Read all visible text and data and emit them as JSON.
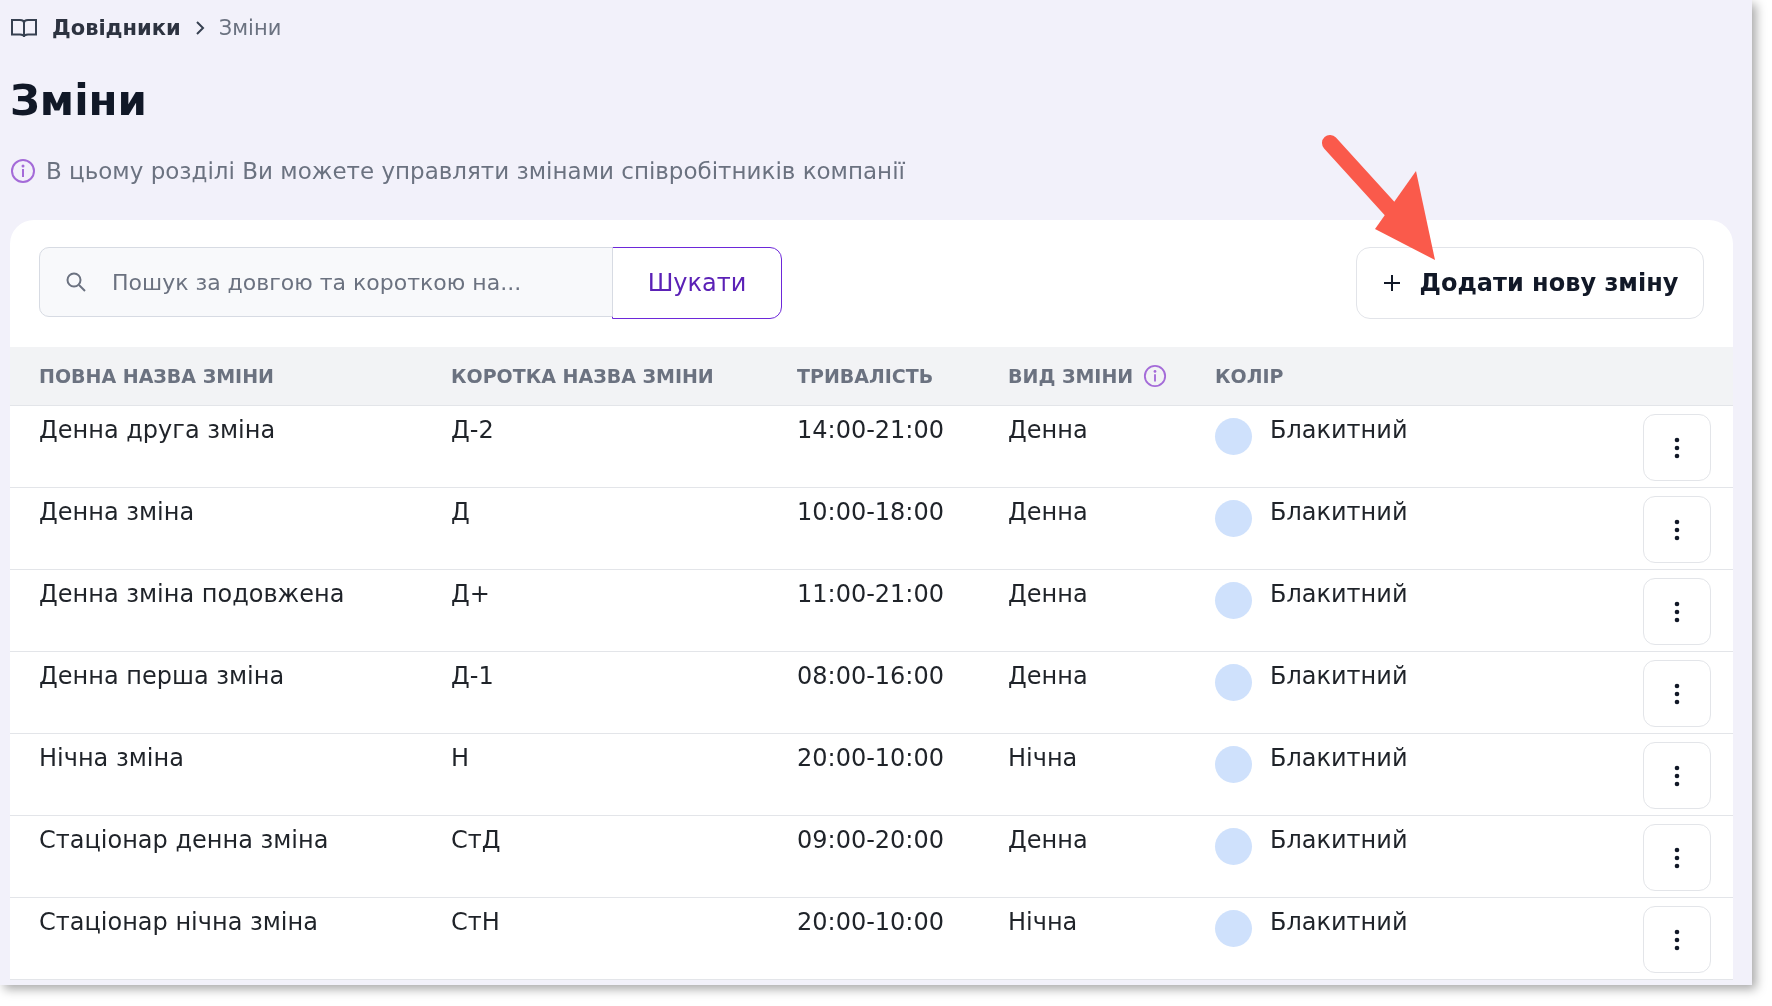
{
  "breadcrumbs": [
    {
      "label": "Довідники",
      "current": false
    },
    {
      "label": "Зміни",
      "current": true
    }
  ],
  "title": "Зміни",
  "info": "В цьому розділі Ви можете управляти змінами співробітників компанії",
  "search": {
    "placeholder": "Пошук за довгою та короткою на...",
    "button": "Шукати"
  },
  "add_button": "Додати нову зміну",
  "table": {
    "columns": [
      {
        "label": "ПОВНА НАЗВА ЗМІНИ",
        "info": false
      },
      {
        "label": "КОРОТКА НАЗВА ЗМІНИ",
        "info": false
      },
      {
        "label": "ТРИВАЛІСТЬ",
        "info": false
      },
      {
        "label": "ВИД ЗМІНИ",
        "info": true
      },
      {
        "label": "КОЛІР",
        "info": false
      }
    ],
    "rows": [
      {
        "full_name": "Денна друга зміна",
        "short_name": "Д-2",
        "duration": "14:00-21:00",
        "type": "Денна",
        "color_name": "Блакитний",
        "color": "#cfe1fc"
      },
      {
        "full_name": "Денна зміна",
        "short_name": "Д",
        "duration": "10:00-18:00",
        "type": "Денна",
        "color_name": "Блакитний",
        "color": "#cfe1fc"
      },
      {
        "full_name": "Денна зміна подовжена",
        "short_name": "Д+",
        "duration": "11:00-21:00",
        "type": "Денна",
        "color_name": "Блакитний",
        "color": "#cfe1fc"
      },
      {
        "full_name": "Денна перша зміна",
        "short_name": "Д-1",
        "duration": "08:00-16:00",
        "type": "Денна",
        "color_name": "Блакитний",
        "color": "#cfe1fc"
      },
      {
        "full_name": "Нічна зміна",
        "short_name": "Н",
        "duration": "20:00-10:00",
        "type": "Нічна",
        "color_name": "Блакитний",
        "color": "#cfe1fc"
      },
      {
        "full_name": "Стаціонар денна зміна",
        "short_name": "СтД",
        "duration": "09:00-20:00",
        "type": "Денна",
        "color_name": "Блакитний",
        "color": "#cfe1fc"
      },
      {
        "full_name": "Стаціонар нічна зміна",
        "short_name": "СтН",
        "duration": "20:00-10:00",
        "type": "Нічна",
        "color_name": "Блакитний",
        "color": "#cfe1fc"
      }
    ]
  }
}
